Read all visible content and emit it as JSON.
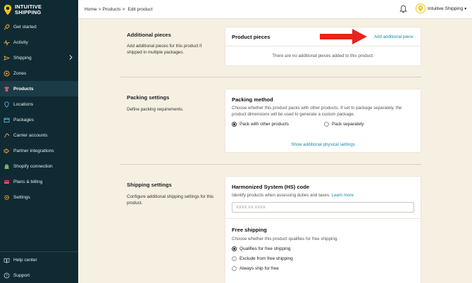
{
  "brand": {
    "line1": "INTUITIVE",
    "line2": "SHIPPING"
  },
  "sidebar": {
    "items": [
      {
        "label": "Get started",
        "icon": "rocket-icon",
        "active": false
      },
      {
        "label": "Activity",
        "icon": "activity-icon",
        "active": false
      },
      {
        "label": "Shipping",
        "icon": "shipping-icon",
        "active": false,
        "has_chevron": true
      },
      {
        "label": "Zones",
        "icon": "zones-icon",
        "active": false
      },
      {
        "label": "Products",
        "icon": "shirt-icon",
        "active": true
      },
      {
        "label": "Locations",
        "icon": "location-icon",
        "active": false
      },
      {
        "label": "Packages",
        "icon": "package-icon",
        "active": false
      },
      {
        "label": "Carrier accounts",
        "icon": "carrier-icon",
        "active": false
      },
      {
        "label": "Partner integrations",
        "icon": "integration-icon",
        "active": false
      },
      {
        "label": "Shopify connection",
        "icon": "shopify-icon",
        "active": false
      },
      {
        "label": "Plans & billing",
        "icon": "billing-icon",
        "active": false
      },
      {
        "label": "Settings",
        "icon": "gear-icon",
        "active": false
      }
    ],
    "bottom": [
      {
        "label": "Help center",
        "icon": "book-icon"
      },
      {
        "label": "Support",
        "icon": "help-icon"
      }
    ]
  },
  "header": {
    "breadcrumb": [
      "Home",
      "Products",
      "Edit product"
    ],
    "separator": ">",
    "account_name": "Intuitive Shipping",
    "account_caret": "▾"
  },
  "sections": {
    "additional": {
      "title": "Additional pieces",
      "description": "Add additional pieces for this product if shipped in multiple packages.",
      "card_title": "Product pieces",
      "add_link": "Add additional piece",
      "empty_text": "There are no additional pieces added to this product."
    },
    "packing": {
      "title": "Packing settings",
      "description": "Define packing requirements.",
      "card_title": "Packing method",
      "card_text": "Choose whether this product packs with other products. If set to package separately, the product dimensions will be used to generate a custom package.",
      "options": [
        "Pack with other products",
        "Pack separately"
      ],
      "selected": "Pack with other products",
      "show_more_link": "Show additional physical settings"
    },
    "shipping": {
      "title": "Shipping settings",
      "description": "Configure additional shipping settings for this product.",
      "hs_title": "Harmonized System (HS) code",
      "hs_text": "Identify products when assessing duties and taxes.",
      "hs_link": "Learn more",
      "hs_placeholder": "XXXX.XX.XXXX",
      "hs_value": "",
      "free_title": "Free shipping",
      "free_text": "Choose whether this product qualifies for free shipping.",
      "free_options": [
        "Qualifies for free shipping",
        "Exclude from free shipping",
        "Always ship for free"
      ],
      "free_selected": "Qualifies for free shipping"
    }
  },
  "colors": {
    "sidebar_bg": "#0f2a33",
    "page_bg": "#f6f0e3",
    "accent_yellow": "#f0c419",
    "link": "#1b8aa8",
    "arrow_red": "#e8231c"
  }
}
